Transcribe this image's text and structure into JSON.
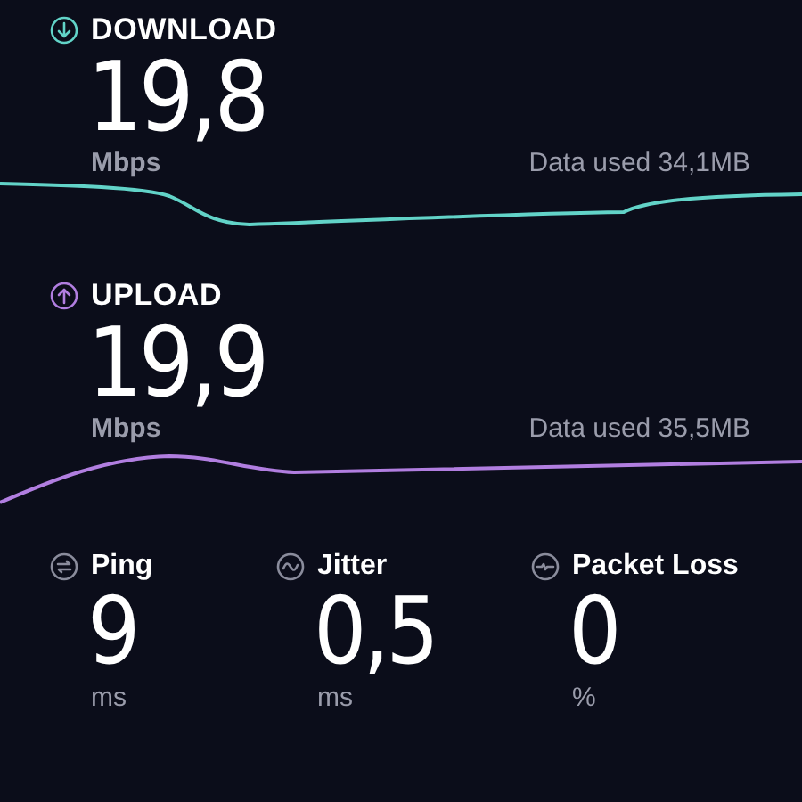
{
  "tests": [
    {
      "kind": "download",
      "title": "DOWNLOAD",
      "value": "19,8",
      "unit": "Mbps",
      "data_used": "Data used 34,1MB"
    },
    {
      "kind": "upload",
      "title": "UPLOAD",
      "value": "19,9",
      "unit": "Mbps",
      "data_used": "Data used 35,5MB"
    }
  ],
  "metrics": [
    {
      "kind": "ping",
      "label": "Ping",
      "value": "9",
      "unit": "ms"
    },
    {
      "kind": "jitter",
      "label": "Jitter",
      "value": "0,5",
      "unit": "ms"
    },
    {
      "kind": "loss",
      "label": "Packet Loss",
      "value": "0",
      "unit": "%"
    }
  ]
}
